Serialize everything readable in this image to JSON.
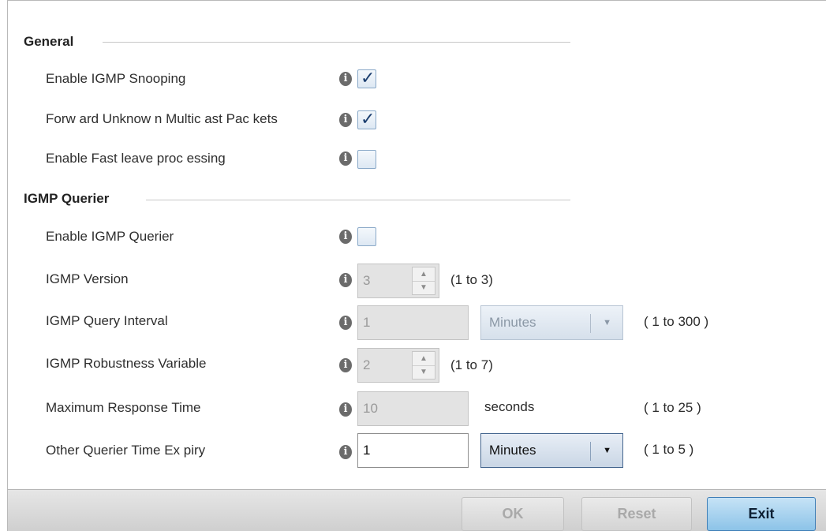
{
  "general": {
    "title": "General",
    "rows": [
      {
        "label": "Enable IGMP Snooping",
        "checked": true
      },
      {
        "label": "Forw ard Unknow n Multic ast Pac kets",
        "checked": true
      },
      {
        "label": "Enable Fast leave proc essing",
        "checked": false
      }
    ]
  },
  "querier": {
    "title": "IGMP Querier",
    "enable_label": "Enable IGMP Querier",
    "enable_checked": false,
    "version": {
      "label": "IGMP Version",
      "value": "3",
      "range": "(1 to 3)"
    },
    "interval": {
      "label": "IGMP Query Interval",
      "value": "1",
      "unit": "Minutes",
      "range": "( 1 to 300 )"
    },
    "robustness": {
      "label": "IGMP Robustness Variable",
      "value": "2",
      "range": "(1 to 7)"
    },
    "max_response": {
      "label": "Maximum Response Time",
      "value": "10",
      "unit": "seconds",
      "range": "( 1 to 25 )"
    },
    "other_expiry": {
      "label": "Other Querier Time Ex piry",
      "value": "1",
      "unit": "Minutes",
      "range": "( 1 to 5 )"
    }
  },
  "icons": {
    "info": "i",
    "check": "✓",
    "up": "▲",
    "down": "▼"
  },
  "footer": {
    "ok": "OK",
    "reset": "Reset",
    "exit": "Exit"
  },
  "colors": {
    "accent": "#8cc3e8",
    "checkmark": "#1a3d6e"
  }
}
